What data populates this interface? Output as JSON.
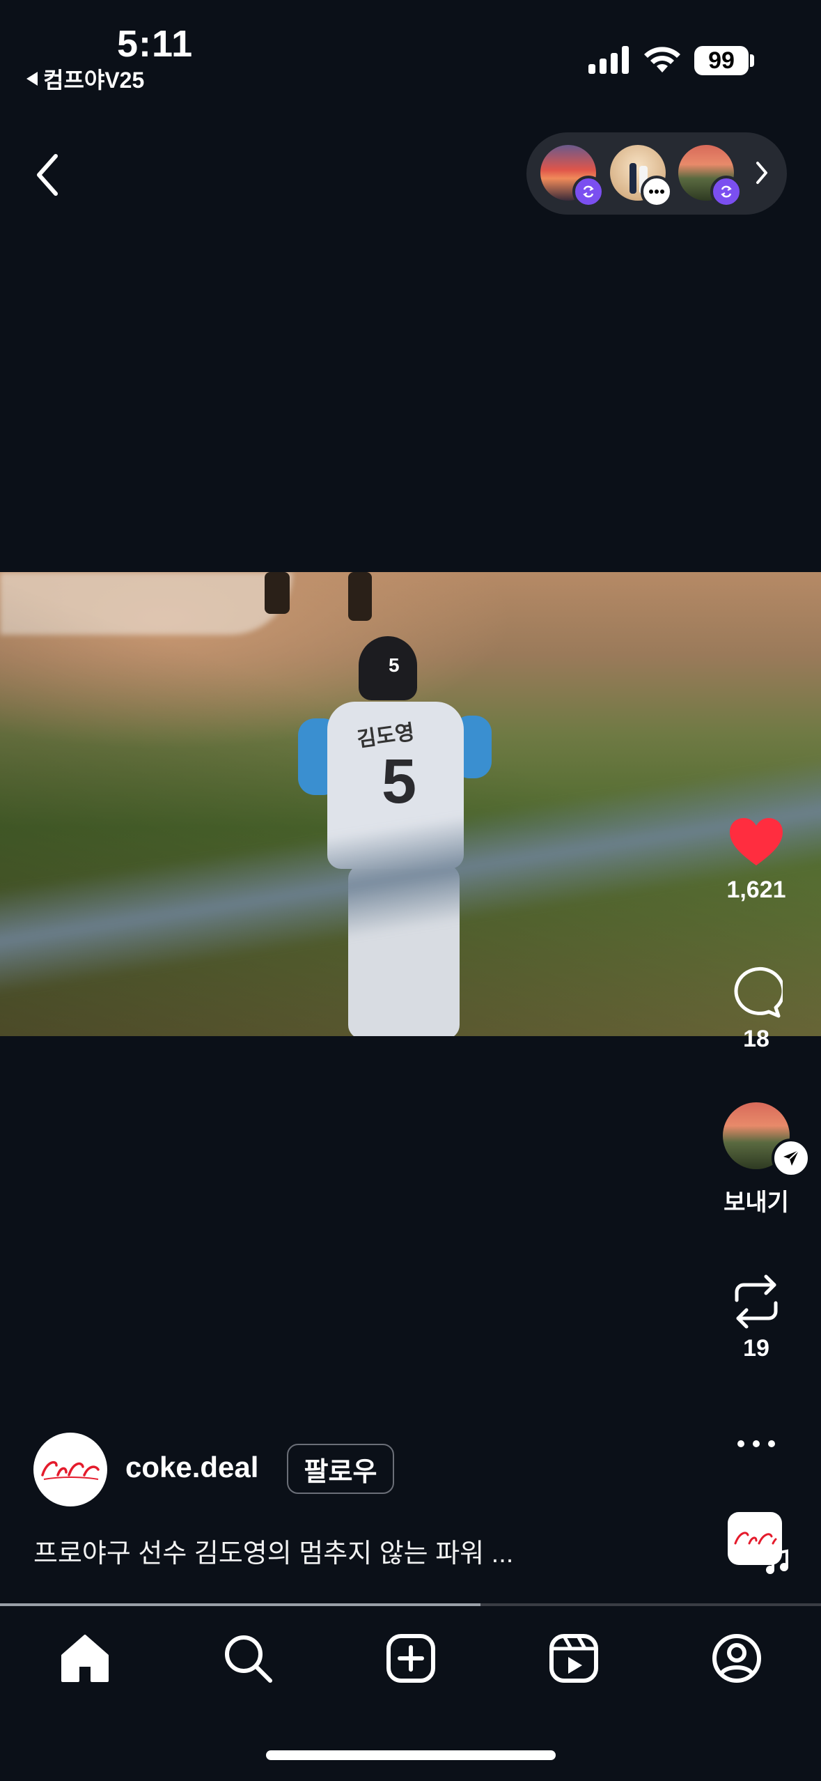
{
  "status_bar": {
    "time": "5:11",
    "back_app": "컴프야V25",
    "battery": "99"
  },
  "post": {
    "username": "coke.deal",
    "follow_label": "팔로우",
    "caption": "프로야구 선수 김도영의 멈추지 않는 파워 ...",
    "jersey_name": "김도영",
    "jersey_number": "5",
    "video_progress": 0.585
  },
  "actions": {
    "likes": "1,621",
    "comments": "18",
    "send_label": "보내기",
    "reposts": "19"
  },
  "tabs": [
    "home-icon",
    "search-icon",
    "create-icon",
    "reels-icon",
    "profile-icon"
  ],
  "colors": {
    "background": "#0b1018",
    "like": "#ff2d3f",
    "story_badge": "#7b4ff0",
    "brand_red": "#e41b2c"
  }
}
